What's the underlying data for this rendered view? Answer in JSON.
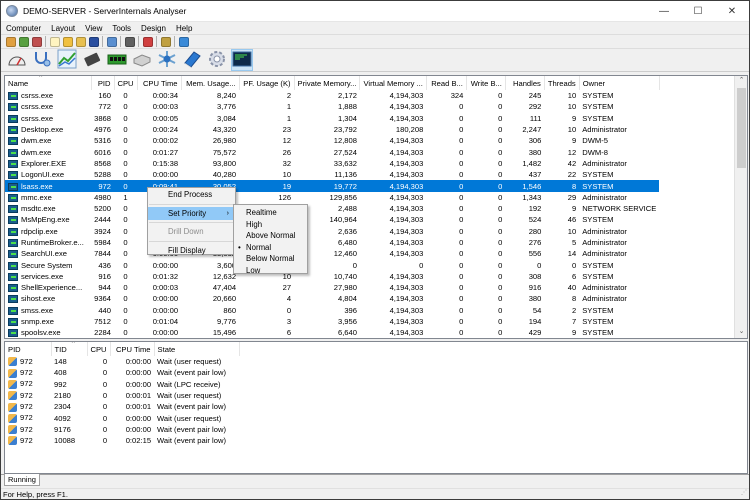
{
  "window": {
    "title": "DEMO-SERVER - ServerInternals Analyser",
    "controls": [
      "minimize",
      "maximize",
      "close"
    ]
  },
  "menubar": [
    "Computer",
    "Layout",
    "View",
    "Tools",
    "Design",
    "Help"
  ],
  "toolbar_small": [
    {
      "icon": "connect-icon",
      "color": "#e0a040"
    },
    {
      "icon": "upload-icon",
      "color": "#58a040"
    },
    {
      "icon": "disconnect-icon",
      "color": "#c05050"
    },
    {
      "sep": true
    },
    {
      "icon": "new-document-icon",
      "color": "#fff4c0"
    },
    {
      "icon": "open-folder-icon",
      "color": "#f0c040"
    },
    {
      "icon": "add-folder-icon",
      "color": "#e8c050"
    },
    {
      "icon": "save-icon",
      "color": "#2a4fa0"
    },
    {
      "sep": true
    },
    {
      "icon": "window-icon",
      "color": "#5a8fd0"
    },
    {
      "sep": true
    },
    {
      "icon": "binoculars-icon",
      "color": "#606060"
    },
    {
      "sep": true
    },
    {
      "icon": "checklist-icon",
      "color": "#d04040"
    },
    {
      "sep": true
    },
    {
      "icon": "edit-icon",
      "color": "#c0a040"
    },
    {
      "sep": true
    },
    {
      "icon": "help-icon",
      "color": "#3a8ad8"
    }
  ],
  "toolbar_large": [
    {
      "icon": "gauge-icon",
      "active": false
    },
    {
      "icon": "stethoscope-icon",
      "active": false
    },
    {
      "icon": "performance-chart-icon",
      "active": false
    },
    {
      "icon": "cpu-chip-icon",
      "active": false
    },
    {
      "icon": "memory-module-icon",
      "active": false
    },
    {
      "icon": "disk-drive-icon",
      "active": false
    },
    {
      "icon": "network-icon",
      "active": false
    },
    {
      "icon": "book-icon",
      "active": false
    },
    {
      "icon": "settings-gear-icon",
      "active": false
    },
    {
      "icon": "processes-console-icon",
      "active": true
    }
  ],
  "process_table": {
    "columns": [
      "Name",
      "PID",
      "CPU",
      "CPU Time",
      "Mem. Usage...",
      "PF. Usage (K)",
      "Private Memory...",
      "Virtual Memory ...",
      "Read B...",
      "Write B...",
      "Handles",
      "Threads",
      "Owner"
    ],
    "sorted_column": "Name",
    "selected_index": 8,
    "rows": [
      [
        "csrss.exe",
        "160",
        "0",
        "0:00:34",
        "8,240",
        "2",
        "2,172",
        "4,194,303",
        "324",
        "0",
        "245",
        "10",
        "SYSTEM"
      ],
      [
        "csrss.exe",
        "772",
        "0",
        "0:00:03",
        "3,776",
        "1",
        "1,888",
        "4,194,303",
        "0",
        "0",
        "292",
        "10",
        "SYSTEM"
      ],
      [
        "csrss.exe",
        "3868",
        "0",
        "0:00:05",
        "3,084",
        "1",
        "1,304",
        "4,194,303",
        "0",
        "0",
        "111",
        "9",
        "SYSTEM"
      ],
      [
        "Desktop.exe",
        "4976",
        "0",
        "0:00:24",
        "43,320",
        "23",
        "23,792",
        "180,208",
        "0",
        "0",
        "2,247",
        "10",
        "Administrator"
      ],
      [
        "dwm.exe",
        "5316",
        "0",
        "0:00:02",
        "26,980",
        "12",
        "12,808",
        "4,194,303",
        "0",
        "0",
        "306",
        "9",
        "DWM-5"
      ],
      [
        "dwm.exe",
        "6016",
        "0",
        "0:01:27",
        "75,572",
        "26",
        "27,524",
        "4,194,303",
        "0",
        "0",
        "380",
        "12",
        "DWM-8"
      ],
      [
        "Explorer.EXE",
        "8568",
        "0",
        "0:15:38",
        "93,800",
        "32",
        "33,632",
        "4,194,303",
        "0",
        "0",
        "1,482",
        "42",
        "Administrator"
      ],
      [
        "LogonUI.exe",
        "5288",
        "0",
        "0:00:00",
        "40,280",
        "10",
        "11,136",
        "4,194,303",
        "0",
        "0",
        "437",
        "22",
        "SYSTEM"
      ],
      [
        "lsass.exe",
        "972",
        "0",
        "0:09:41",
        "30,052",
        "19",
        "19,772",
        "4,194,303",
        "0",
        "0",
        "1,546",
        "8",
        "SYSTEM"
      ],
      [
        "mmc.exe",
        "4980",
        "1",
        "",
        "",
        "126",
        "129,856",
        "4,194,303",
        "0",
        "0",
        "1,343",
        "29",
        "Administrator"
      ],
      [
        "msdtc.exe",
        "5200",
        "0",
        "",
        "",
        "",
        "2,488",
        "4,194,303",
        "0",
        "0",
        "192",
        "9",
        "NETWORK SERVICE"
      ],
      [
        "MsMpEng.exe",
        "2444",
        "0",
        "",
        "",
        "",
        "140,964",
        "4,194,303",
        "0",
        "0",
        "524",
        "46",
        "SYSTEM"
      ],
      [
        "rdpclip.exe",
        "3924",
        "0",
        "",
        "",
        "",
        "2,636",
        "4,194,303",
        "0",
        "0",
        "280",
        "10",
        "Administrator"
      ],
      [
        "RuntimeBroker.e...",
        "5984",
        "0",
        "",
        "",
        "",
        "6,480",
        "4,194,303",
        "0",
        "0",
        "276",
        "5",
        "Administrator"
      ],
      [
        "SearchUI.exe",
        "7844",
        "0",
        "0:00:00",
        "33,032",
        "",
        "12,460",
        "4,194,303",
        "0",
        "0",
        "556",
        "14",
        "Administrator"
      ],
      [
        "Secure System",
        "436",
        "0",
        "0:00:00",
        "3,600",
        "",
        "0",
        "0",
        "0",
        "0",
        "0",
        "0",
        "SYSTEM"
      ],
      [
        "services.exe",
        "916",
        "0",
        "0:01:32",
        "12,632",
        "10",
        "10,740",
        "4,194,303",
        "0",
        "0",
        "308",
        "6",
        "SYSTEM"
      ],
      [
        "ShellExperience...",
        "944",
        "0",
        "0:00:03",
        "47,404",
        "27",
        "27,980",
        "4,194,303",
        "0",
        "0",
        "916",
        "40",
        "Administrator"
      ],
      [
        "sihost.exe",
        "9364",
        "0",
        "0:00:00",
        "20,660",
        "4",
        "4,804",
        "4,194,303",
        "0",
        "0",
        "380",
        "8",
        "Administrator"
      ],
      [
        "smss.exe",
        "440",
        "0",
        "0:00:00",
        "860",
        "0",
        "396",
        "4,194,303",
        "0",
        "0",
        "54",
        "2",
        "SYSTEM"
      ],
      [
        "snmp.exe",
        "7512",
        "0",
        "0:01:04",
        "9,776",
        "3",
        "3,956",
        "4,194,303",
        "0",
        "0",
        "194",
        "7",
        "SYSTEM"
      ],
      [
        "spoolsv.exe",
        "2284",
        "0",
        "0:00:00",
        "15,496",
        "6",
        "6,640",
        "4,194,303",
        "0",
        "0",
        "429",
        "9",
        "SYSTEM"
      ]
    ]
  },
  "context_menu": {
    "items": [
      {
        "label": "End Process",
        "state": "normal"
      },
      {
        "sep": true
      },
      {
        "label": "Set Priority",
        "state": "highlighted",
        "submenu": true
      },
      {
        "sep": true
      },
      {
        "label": "Drill Down",
        "state": "disabled"
      },
      {
        "sep": true
      },
      {
        "label": "Fill Display",
        "state": "normal"
      }
    ],
    "submenu": {
      "items": [
        "Realtime",
        "High",
        "Above Normal",
        "Normal",
        "Below Normal",
        "Low"
      ],
      "checked": "Normal"
    }
  },
  "thread_table": {
    "columns": [
      "PID",
      "TID",
      "CPU",
      "CPU Time",
      "State"
    ],
    "sorted_column": "TID",
    "rows": [
      [
        "972",
        "148",
        "0",
        "0:00:00",
        "Wait (user request)"
      ],
      [
        "972",
        "408",
        "0",
        "0:00:00",
        "Wait (event pair low)"
      ],
      [
        "972",
        "992",
        "0",
        "0:00:00",
        "Wait (LPC receive)"
      ],
      [
        "972",
        "2180",
        "0",
        "0:00:01",
        "Wait (user request)"
      ],
      [
        "972",
        "2304",
        "0",
        "0:00:01",
        "Wait (event pair low)"
      ],
      [
        "972",
        "4092",
        "0",
        "0:00:00",
        "Wait (user request)"
      ],
      [
        "972",
        "9176",
        "0",
        "0:00:00",
        "Wait (event pair low)"
      ],
      [
        "972",
        "10088",
        "0",
        "0:02:15",
        "Wait (event pair low)"
      ]
    ]
  },
  "tabs": [
    {
      "label": "Running",
      "active": true
    }
  ],
  "statusbar": {
    "text": "For Help, press F1."
  },
  "colors": {
    "selection": "#0078d7",
    "menu_highlight": "#91c9f7",
    "active_tool": "#cce4f7"
  }
}
